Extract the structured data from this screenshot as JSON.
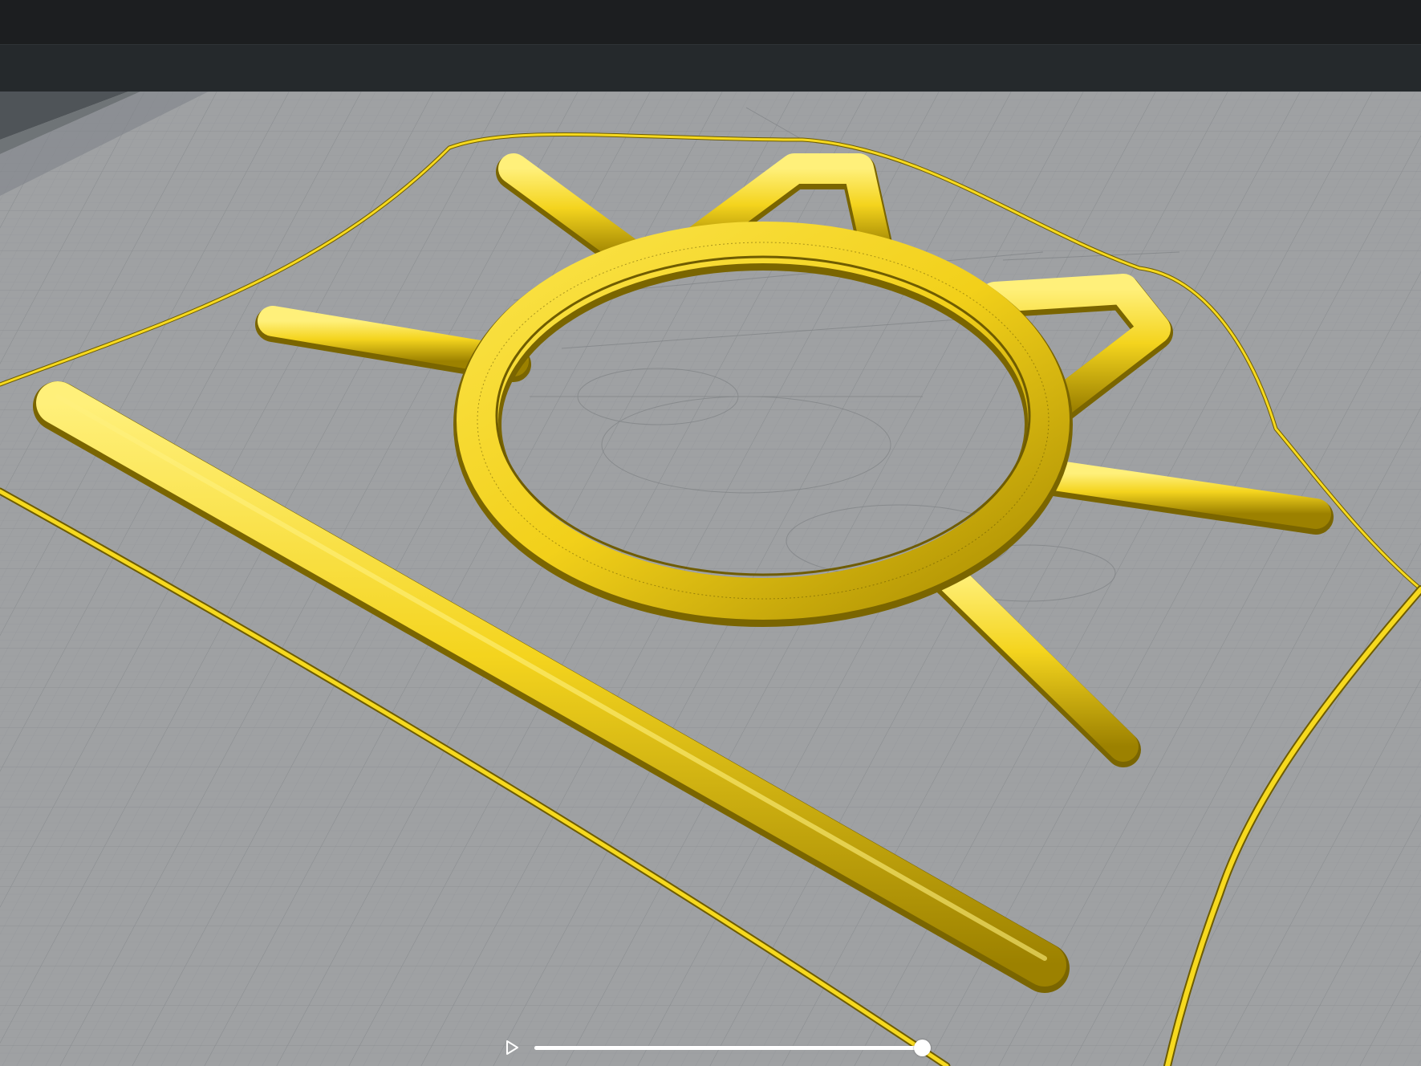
{
  "colors": {
    "titlebar": "#1c1e20",
    "toolbar": "#25292c",
    "bed": "#9fa1a3",
    "filament": "#f2d21c",
    "filament_shadow": "#8a7400",
    "grid": "#8d9092"
  },
  "icons": {
    "play": "play-icon"
  },
  "playback": {
    "progress": 0.99
  }
}
